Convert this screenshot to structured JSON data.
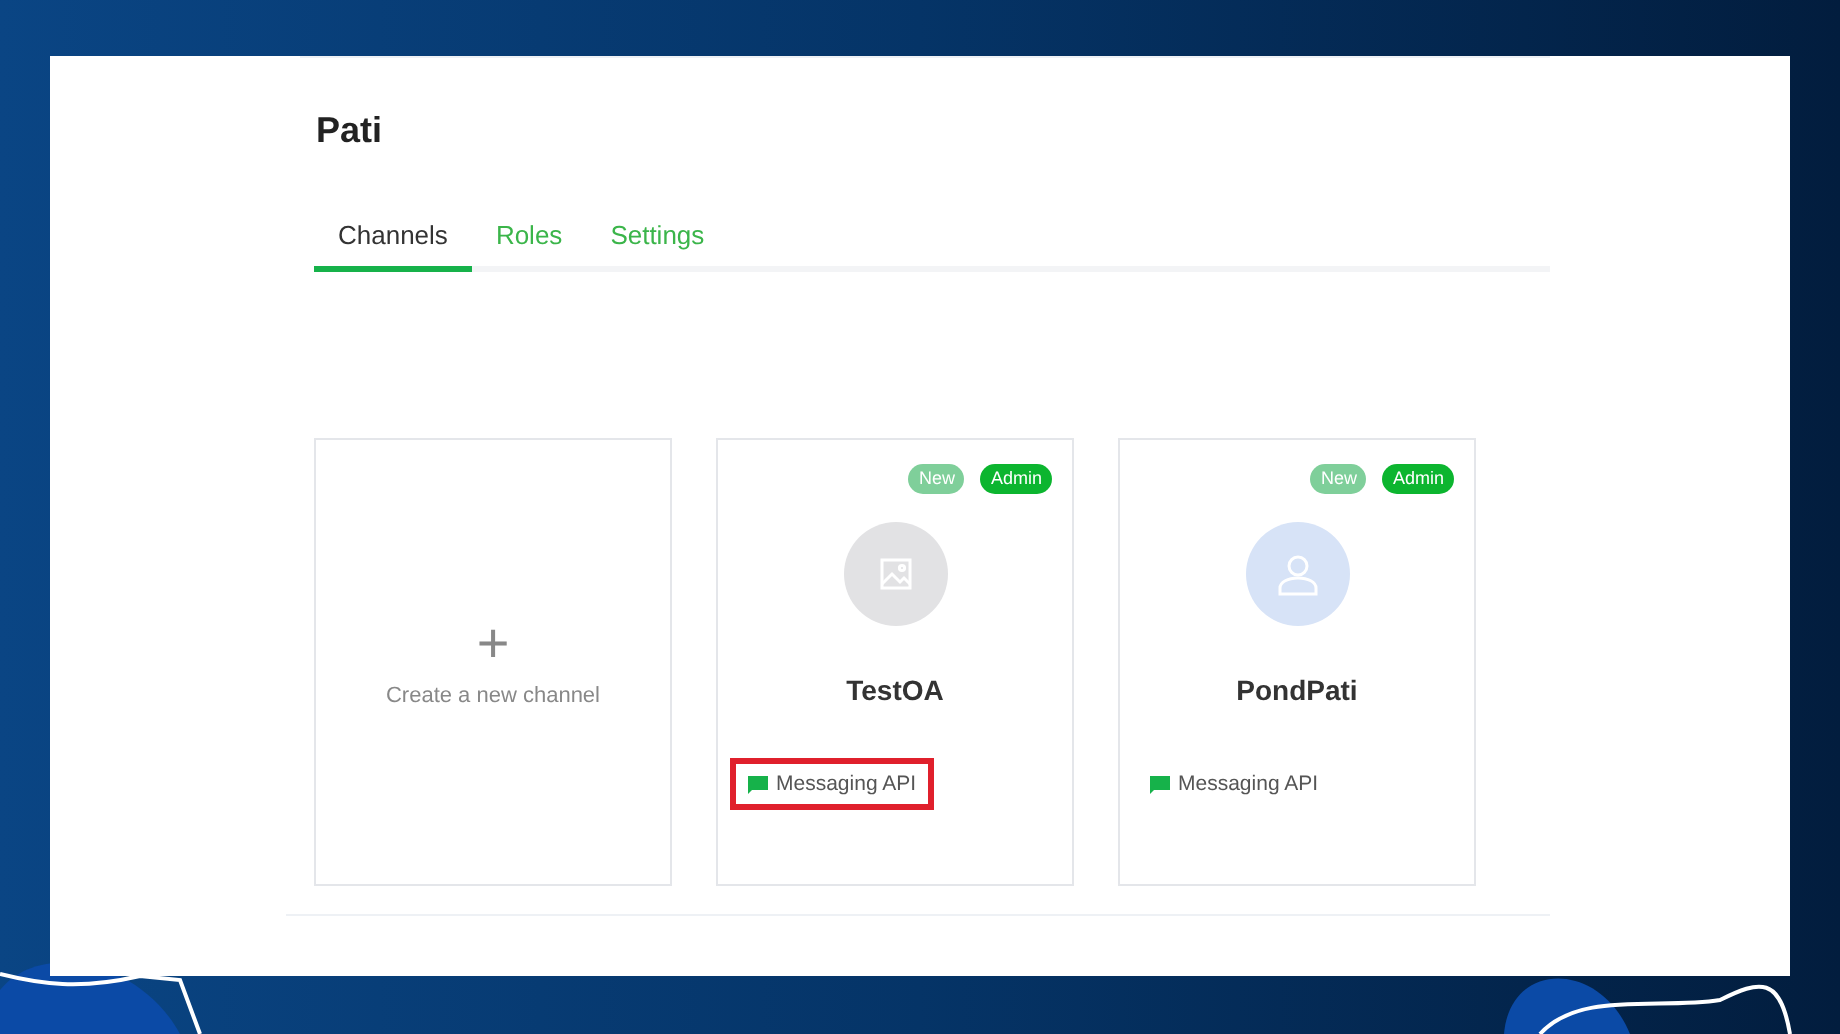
{
  "page": {
    "title": "Pati"
  },
  "tabs": [
    {
      "label": "Channels",
      "selected": true
    },
    {
      "label": "Roles",
      "selected": false
    },
    {
      "label": "Settings",
      "selected": false
    }
  ],
  "create_card": {
    "icon": "+",
    "label": "Create a new channel"
  },
  "channels": [
    {
      "name": "TestOA",
      "kind": "image",
      "badges": [
        {
          "label": "New",
          "kind": "new"
        },
        {
          "label": "Admin",
          "kind": "admin"
        }
      ],
      "type": "Messaging API",
      "highlighted": true
    },
    {
      "name": "PondPati",
      "kind": "person",
      "badges": [
        {
          "label": "New",
          "kind": "new"
        },
        {
          "label": "Admin",
          "kind": "admin"
        }
      ],
      "type": "Messaging API",
      "highlighted": false
    }
  ]
}
